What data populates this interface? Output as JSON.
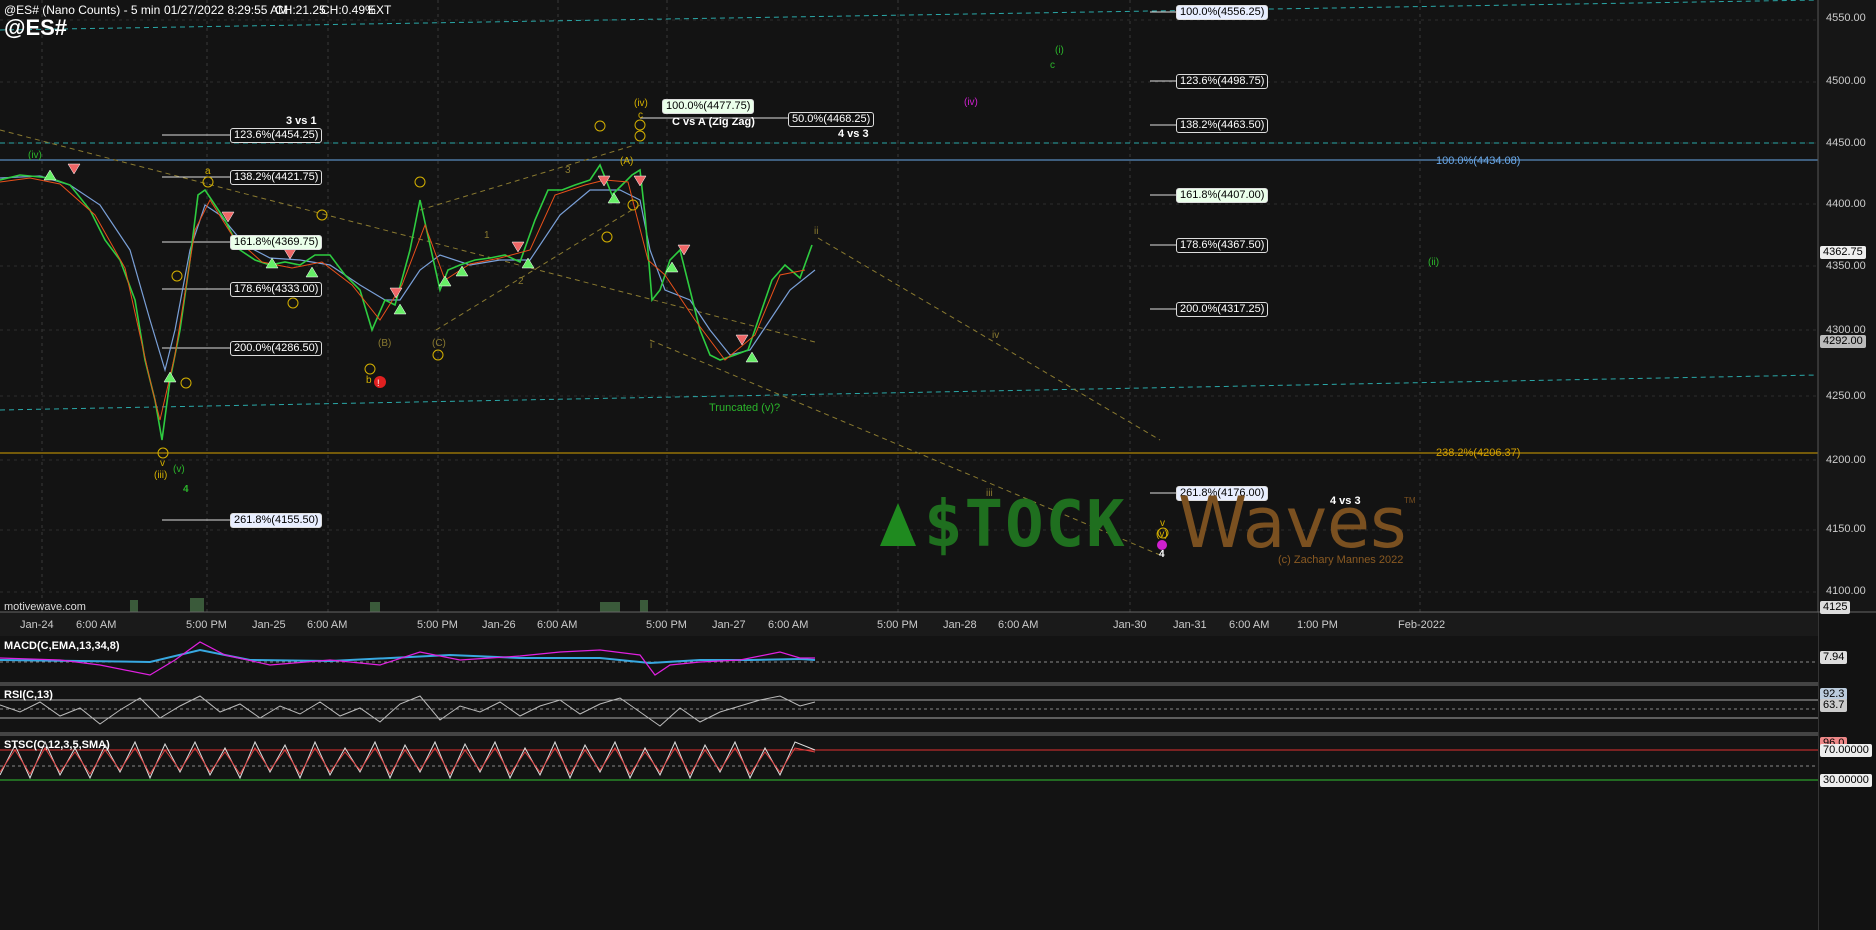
{
  "header": {
    "title": "@ES# (Nano Counts) - 5 min",
    "datetime": "01/27/2022 8:29:55 AM",
    "change_abs": "CH:21.25",
    "change_pct": "CH:0.49%",
    "session": "EXT",
    "symbol": "@ES#"
  },
  "price_axis": {
    "ticks": [
      "4550.00",
      "4500.00",
      "4450.00",
      "4400.00",
      "4350.00",
      "4300.00",
      "4250.00",
      "4200.00",
      "4150.00",
      "4100.00"
    ],
    "last_price": "4362.75",
    "marker_4292": "4292.00",
    "marker_4125": "4125"
  },
  "time_axis": {
    "labels": [
      "Jan-24",
      "6:00 AM",
      "5:00 PM",
      "Jan-25",
      "6:00 AM",
      "5:00 PM",
      "Jan-26",
      "6:00 AM",
      "5:00 PM",
      "Jan-27",
      "6:00 AM",
      "5:00 PM",
      "Jan-28",
      "6:00 AM",
      "Jan-30",
      "Jan-31",
      "6:00 AM",
      "1:00 PM",
      "Feb-2022"
    ]
  },
  "fib_left": [
    "123.6%(4454.25)",
    "138.2%(4421.75)",
    "161.8%(4369.75)",
    "178.6%(4333.00)",
    "200.0%(4286.50)",
    "261.8%(4155.50)"
  ],
  "fib_mid": [
    "100.0%(4477.75)",
    "50.0%(4468.25)"
  ],
  "fib_right": [
    "100.0%(4556.25)",
    "123.6%(4498.75)",
    "138.2%(4463.50)",
    "161.8%(4407.00)",
    "178.6%(4367.50)",
    "200.0%(4317.25)",
    "261.8%(4176.00)"
  ],
  "line_labels": {
    "blue_line": "100.0%(4434.08)",
    "orange_line": "238.2%(4206.37)"
  },
  "annotations": {
    "three_vs_one": "3 vs 1",
    "c_vs_a": "C vs A (Zig Zag)",
    "four_vs_three": "4 vs 3",
    "four_vs_three_b": "4 vs 3",
    "truncated": "Truncated (v)?",
    "watermark_site": "motivewave.com",
    "copyright": "(c) Zachary Mannes 2022",
    "logo_left": "$TOCK",
    "logo_right": "Waves",
    "tm": "TM"
  },
  "waves": {
    "iv_left": "(iv)",
    "iii": "(iii)",
    "v_small": "v",
    "v_paren": "(v)",
    "four": "4",
    "a_small": "a",
    "b_small": "b",
    "iv_top": "(iv)",
    "c_top": "c",
    "i_green": "(i)",
    "c_green": "c",
    "iv_magenta": "(iv)",
    "ii_green": "(ii)",
    "ii_small": "ii",
    "iv_small": "iv",
    "iii_small": "iii",
    "v_right": "v",
    "v_paren_right": "(v)",
    "four_right": "4",
    "A_paren": "(A)",
    "B_paren": "(B)",
    "C_paren": "(C)",
    "one": "1",
    "two": "2",
    "three": "3",
    "i_small": "i"
  },
  "indicators": {
    "macd_label": "MACD(C,EMA,13,34,8)",
    "macd_value": "7.94",
    "rsi_label": "RSI(C,13)",
    "rsi_value_a": "92.3",
    "rsi_value_b": "63.7",
    "stoch_label": "STSC(C,12,3,5,SMA)",
    "stoch_value": "96.0",
    "stoch_upper": "70.00000",
    "stoch_lower": "30.00000"
  },
  "colors": {
    "background": "#121212",
    "price_line": "#4a90e2",
    "candle_up": "#2ecc40",
    "candle_down": "#e8501a",
    "fib_yellow": "#d4b000",
    "wave_green": "#2bb52b",
    "magenta": "#d020d0",
    "logo_green": "#1f8a1f",
    "logo_brown": "#8a5a22"
  }
}
